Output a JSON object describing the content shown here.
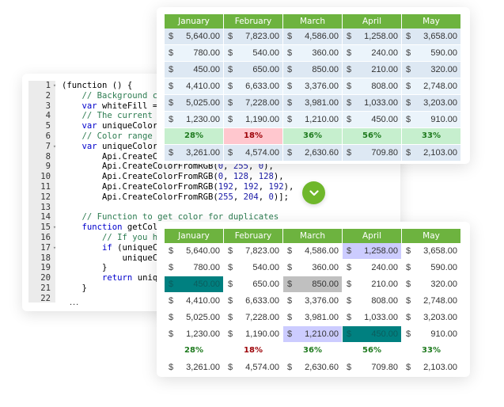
{
  "code_editor": {
    "lines": [
      {
        "n": "1",
        "fold": true,
        "tokens": [
          [
            "",
            "(function () {"
          ]
        ]
      },
      {
        "n": "2",
        "fold": false,
        "tokens": [
          [
            "",
            "    "
          ],
          [
            "cm",
            "// Background color"
          ]
        ]
      },
      {
        "n": "3",
        "fold": false,
        "tokens": [
          [
            "",
            "    "
          ],
          [
            "kw",
            "var"
          ],
          [
            "",
            " whiteFill = Api"
          ]
        ]
      },
      {
        "n": "4",
        "fold": false,
        "tokens": [
          [
            "",
            "    "
          ],
          [
            "cm",
            "// The current index"
          ]
        ]
      },
      {
        "n": "5",
        "fold": false,
        "tokens": [
          [
            "",
            "    "
          ],
          [
            "kw",
            "var"
          ],
          [
            "",
            " uniqueColorIndex"
          ]
        ]
      },
      {
        "n": "6",
        "fold": false,
        "tokens": [
          [
            "",
            "    "
          ],
          [
            "cm",
            "// Color range to highlight"
          ]
        ]
      },
      {
        "n": "7",
        "fold": true,
        "tokens": [
          [
            "",
            "    "
          ],
          [
            "kw",
            "var"
          ],
          [
            "",
            " uniqueColors = ["
          ]
        ]
      },
      {
        "n": "8",
        "fold": false,
        "tokens": [
          [
            "",
            "        Api.CreateColor"
          ]
        ]
      },
      {
        "n": "9",
        "fold": false,
        "tokens": [
          [
            "",
            "        Api.CreateColorFromRGB("
          ],
          [
            "num",
            "0"
          ],
          [
            "",
            ", "
          ],
          [
            "num",
            "255"
          ],
          [
            "",
            ", "
          ],
          [
            "num",
            "0"
          ],
          [
            "",
            "),"
          ]
        ]
      },
      {
        "n": "10",
        "fold": false,
        "tokens": [
          [
            "",
            "        Api.CreateColorFromRGB("
          ],
          [
            "num",
            "0"
          ],
          [
            "",
            ", "
          ],
          [
            "num",
            "128"
          ],
          [
            "",
            ", "
          ],
          [
            "num",
            "128"
          ],
          [
            "",
            "),"
          ]
        ]
      },
      {
        "n": "11",
        "fold": false,
        "tokens": [
          [
            "",
            "        Api.CreateColorFromRGB("
          ],
          [
            "num",
            "192"
          ],
          [
            "",
            ", "
          ],
          [
            "num",
            "192"
          ],
          [
            "",
            ", "
          ],
          [
            "num",
            "192"
          ],
          [
            "",
            "),"
          ]
        ]
      },
      {
        "n": "12",
        "fold": false,
        "tokens": [
          [
            "",
            "        Api.CreateColorFromRGB("
          ],
          [
            "num",
            "255"
          ],
          [
            "",
            ", "
          ],
          [
            "num",
            "204"
          ],
          [
            "",
            ", "
          ],
          [
            "num",
            "0"
          ],
          [
            "",
            ")];"
          ]
        ]
      },
      {
        "n": "13",
        "fold": false,
        "tokens": [
          [
            "",
            ""
          ]
        ]
      },
      {
        "n": "14",
        "fold": false,
        "tokens": [
          [
            "",
            "    "
          ],
          [
            "cm",
            "// Function to get color for duplicates"
          ]
        ]
      },
      {
        "n": "15",
        "fold": true,
        "tokens": [
          [
            "",
            "    "
          ],
          [
            "kw",
            "function"
          ],
          [
            "",
            " getColor()"
          ]
        ]
      },
      {
        "n": "16",
        "fold": false,
        "tokens": [
          [
            "",
            "        "
          ],
          [
            "cm",
            "// If you have"
          ]
        ]
      },
      {
        "n": "17",
        "fold": true,
        "tokens": [
          [
            "",
            "        "
          ],
          [
            "kw",
            "if"
          ],
          [
            "",
            " (uniqueColor"
          ]
        ]
      },
      {
        "n": "18",
        "fold": false,
        "tokens": [
          [
            "",
            "            uniqueColor"
          ]
        ]
      },
      {
        "n": "19",
        "fold": false,
        "tokens": [
          [
            "",
            "        }"
          ]
        ]
      },
      {
        "n": "20",
        "fold": false,
        "tokens": [
          [
            "",
            "        "
          ],
          [
            "kw",
            "return"
          ],
          [
            "",
            " uniqueCo"
          ]
        ]
      },
      {
        "n": "21",
        "fold": false,
        "tokens": [
          [
            "",
            "    }"
          ]
        ]
      },
      {
        "n": "22",
        "fold": false,
        "tokens": [
          [
            "",
            ""
          ]
        ]
      }
    ],
    "ellipsis": "..."
  },
  "table_before": {
    "headers": [
      "January",
      "February",
      "March",
      "April",
      "May"
    ],
    "currency": "$",
    "rows": [
      [
        "5,640.00",
        "7,823.00",
        "4,586.00",
        "1,258.00",
        "3,658.00"
      ],
      [
        "780.00",
        "540.00",
        "360.00",
        "240.00",
        "590.00"
      ],
      [
        "450.00",
        "650.00",
        "850.00",
        "210.00",
        "320.00"
      ],
      [
        "4,410.00",
        "6,633.00",
        "3,376.00",
        "808.00",
        "2,748.00"
      ],
      [
        "5,025.00",
        "7,228.00",
        "3,981.00",
        "1,033.00",
        "3,203.00"
      ],
      [
        "1,230.00",
        "1,190.00",
        "1,210.00",
        "450.00",
        "910.00"
      ]
    ],
    "percentages": [
      {
        "value": "28%",
        "status": "positive"
      },
      {
        "value": "18%",
        "status": "negative"
      },
      {
        "value": "36%",
        "status": "positive"
      },
      {
        "value": "56%",
        "status": "positive"
      },
      {
        "value": "33%",
        "status": "positive"
      }
    ],
    "totals": [
      "3,261.00",
      "4,574.00",
      "2,630.60",
      "709.80",
      "2,103.00"
    ]
  },
  "table_after": {
    "headers": [
      "January",
      "February",
      "March",
      "April",
      "May"
    ],
    "currency": "$",
    "rows": [
      [
        "5,640.00",
        "7,823.00",
        "4,586.00",
        "1,258.00",
        "3,658.00"
      ],
      [
        "780.00",
        "540.00",
        "360.00",
        "240.00",
        "590.00"
      ],
      [
        "450.00",
        "650.00",
        "850.00",
        "210.00",
        "320.00"
      ],
      [
        "4,410.00",
        "6,633.00",
        "3,376.00",
        "808.00",
        "2,748.00"
      ],
      [
        "5,025.00",
        "7,228.00",
        "3,981.00",
        "1,033.00",
        "3,203.00"
      ],
      [
        "1,230.00",
        "1,190.00",
        "1,210.00",
        "450.00",
        "910.00"
      ]
    ],
    "highlights": [
      {
        "row": 0,
        "col": 3,
        "color": "lavender"
      },
      {
        "row": 2,
        "col": 0,
        "color": "teal"
      },
      {
        "row": 2,
        "col": 2,
        "color": "gray"
      },
      {
        "row": 5,
        "col": 2,
        "color": "lavender"
      },
      {
        "row": 5,
        "col": 3,
        "color": "teal"
      }
    ],
    "percentages": [
      {
        "value": "28%",
        "status": "positive"
      },
      {
        "value": "18%",
        "status": "negative"
      },
      {
        "value": "36%",
        "status": "positive"
      },
      {
        "value": "56%",
        "status": "positive"
      },
      {
        "value": "33%",
        "status": "positive"
      }
    ],
    "totals": [
      "3,261.00",
      "4,574.00",
      "2,630.60",
      "709.80",
      "2,103.00"
    ]
  },
  "colors": {
    "header_green": "#6db33f",
    "button_green": "#6fb72b",
    "highlight_lavender": "#ccccff",
    "highlight_teal": "#008080",
    "highlight_gray": "#c0c0c0",
    "pct_positive_bg": "#c6efce",
    "pct_negative_bg": "#ffc7ce"
  },
  "transition_button": {
    "icon": "chevron-down-icon"
  }
}
